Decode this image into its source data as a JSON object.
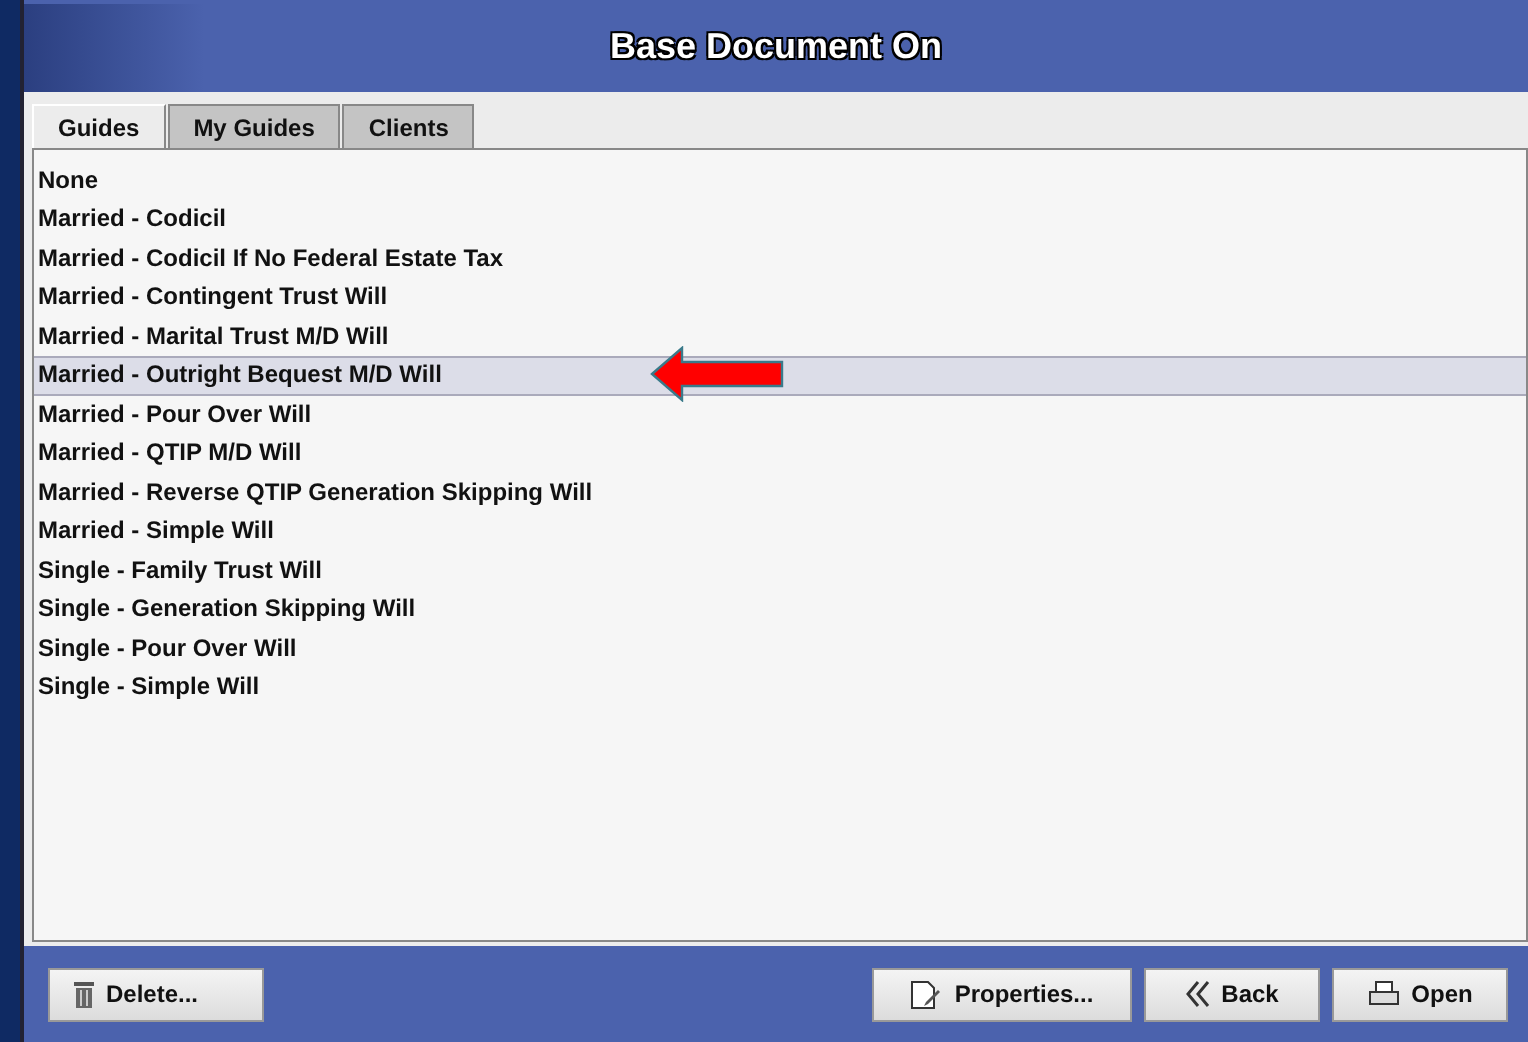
{
  "window": {
    "title": "Base Document On"
  },
  "tabs": [
    {
      "label": "Guides",
      "selected": true
    },
    {
      "label": "My Guides",
      "selected": false
    },
    {
      "label": "Clients",
      "selected": false
    }
  ],
  "guides": [
    {
      "label": "None",
      "selected": false
    },
    {
      "label": "Married - Codicil",
      "selected": false
    },
    {
      "label": "Married - Codicil If No Federal Estate Tax",
      "selected": false
    },
    {
      "label": "Married - Contingent Trust Will",
      "selected": false
    },
    {
      "label": "Married - Marital Trust M/D Will",
      "selected": false
    },
    {
      "label": "Married - Outright Bequest M/D Will",
      "selected": true
    },
    {
      "label": "Married - Pour Over Will",
      "selected": false
    },
    {
      "label": "Married - QTIP M/D Will",
      "selected": false
    },
    {
      "label": "Married - Reverse QTIP Generation Skipping Will",
      "selected": false
    },
    {
      "label": "Married - Simple Will",
      "selected": false
    },
    {
      "label": "Single - Family Trust Will",
      "selected": false
    },
    {
      "label": "Single - Generation Skipping Will",
      "selected": false
    },
    {
      "label": "Single - Pour Over Will",
      "selected": false
    },
    {
      "label": "Single - Simple Will",
      "selected": false
    }
  ],
  "buttons": [
    {
      "label": "Delete...",
      "kind": "delete"
    },
    {
      "label": "Properties...",
      "kind": "properties"
    },
    {
      "label": "Back",
      "kind": "back"
    },
    {
      "label": "Open",
      "kind": "open"
    }
  ]
}
